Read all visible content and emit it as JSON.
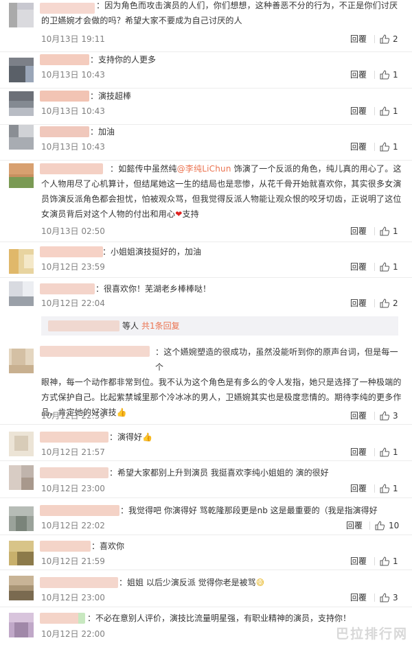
{
  "comments": [
    {
      "lines": [
        "：因为角色而攻击演员的人们，你们想想，这种善恶不分的行为，不正是你们讨厌",
        "的卫嬿婉才会做的吗？希望大家不要成为自己讨厌的人"
      ],
      "time": "10月13日 19:11",
      "reply": "回覆",
      "likes": "2"
    },
    {
      "lines": [
        "：支持你的人更多"
      ],
      "time": "10月13日 10:43",
      "reply": "回覆",
      "likes": "1"
    },
    {
      "lines": [
        "：演技超棒"
      ],
      "time": "10月13日 10:43",
      "reply": "回覆",
      "likes": "1"
    },
    {
      "lines": [
        "：加油"
      ],
      "time": "10月13日 10:43",
      "reply": "回覆",
      "likes": "1"
    },
    {
      "line1_pre": "：如懿传中虽然纯",
      "mention": "@李纯LiChun",
      "line1_post": " 饰演了一个反派的角色，纯儿真的用心了。这",
      "lines_mid": [
        "个人物用尽了心机算计，但结尾她这一生的结局也是悲惨，从花千骨开始就喜欢你，其实很多女演",
        "员饰演反派角色都会担忧，怕被观众骂，但我觉得反派人物能让观众恨的咬牙切齿，正说明了这位"
      ],
      "line_last_pre": "女演员背后对这个人物的付出和用心",
      "heart": "❤",
      "line_last_post": "支持",
      "time": "10月13日 02:50",
      "reply": "回覆",
      "likes": "1"
    },
    {
      "lines": [
        "：小姐姐演技挺好的，加油"
      ],
      "time": "10月12日 23:59",
      "reply": "回覆",
      "likes": "1"
    },
    {
      "lines": [
        "：很喜欢你！芜湖老乡棒棒哒！"
      ],
      "time": "10月12日 22:04",
      "reply": "回覆",
      "likes": "2"
    },
    {
      "lines": [
        "：这个嬿婉塑造的很成功，虽然没能听到你的原声台词，但是每一个",
        "眼神，每一个动作都非常到位。我不认为这个角色是有多么的令人发指，她只是选择了一种极端的",
        "方式保护自己。比起紫禁城里那个冷冰冰的男人，卫嬿婉其实也是极度悲情的。期待李纯的更多作"
      ],
      "line_last": "品，肯定她的好演技",
      "thumb": "👍",
      "time": "10月12日 22:59",
      "reply": "回覆",
      "likes": "3"
    },
    {
      "lines": [
        "：演得好"
      ],
      "thumb": "👍",
      "time": "10月12日 21:57",
      "reply": "回覆",
      "likes": "1"
    },
    {
      "lines": [
        "：希望大家都别上升到演员 我挺喜欢李纯小姐姐的 演的很好"
      ],
      "time": "10月12日 23:00",
      "reply": "回覆",
      "likes": "1"
    },
    {
      "lines": [
        "：我觉得吧 你演得好 骂乾隆那段更是nb 这是最重要的（我是指演得好"
      ],
      "time": "10月12日 22:02",
      "reply": "回覆",
      "likes": "10"
    },
    {
      "lines": [
        "：喜欢你"
      ],
      "time": "10月12日 21:59",
      "reply": "回覆",
      "likes": "1"
    },
    {
      "lines": [
        "：姐姐 以后少演反派 觉得你老是被骂"
      ],
      "emoji": "😅",
      "time": "10月12日 23:00",
      "reply": "回覆",
      "likes": "3"
    },
    {
      "lines": [
        "：不必在意别人评价，演技比流量明星强，有职业精神的演员，支持你！"
      ],
      "time": "10月12日 22:00"
    }
  ],
  "subreply": {
    "prefix": "等人 ",
    "link": "共1条回复"
  },
  "watermark": "巴拉排行网",
  "colors": {
    "accent": "#eb7350",
    "text": "#333333",
    "time": "#808080"
  }
}
